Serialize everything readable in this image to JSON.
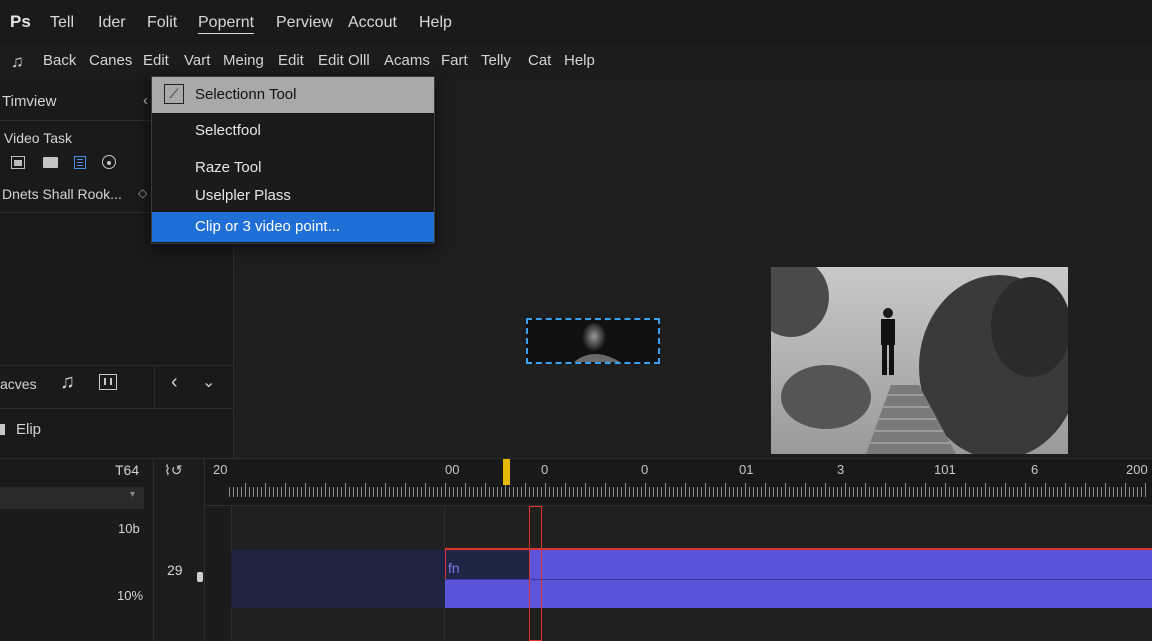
{
  "app": {
    "logo": "Ps"
  },
  "menubar": {
    "items": [
      "Tell",
      "Ider",
      "Folit",
      "Popernt",
      "Perview",
      "Accout",
      "Help"
    ]
  },
  "toolbar": {
    "items": [
      "Back",
      "Canes",
      "Edit",
      "Vart",
      "Meing",
      "Edit",
      "Edit Olll",
      "Acams",
      "Fart",
      "Telly",
      "Cat",
      "Help"
    ]
  },
  "left_panel": {
    "title": "Timview",
    "section": "Video Task",
    "row_label": "Dnets Shall Rook...",
    "tab_label": "acves",
    "clip_label": "Elip",
    "track_name": "T64",
    "value_top": "10b",
    "value_bottom": "10%",
    "track_number": "29"
  },
  "dropdown": {
    "items": [
      "Selectionn Tool",
      "Selectfool",
      "Raze Tool",
      "Uselpler Plass",
      "Clip or 3 video point..."
    ]
  },
  "timeline": {
    "ruler_labels": [
      "20",
      "00",
      "0",
      "0",
      "01",
      "3",
      "101",
      "6",
      "200"
    ],
    "clip_label": "fn"
  },
  "colors": {
    "accent": "#1f6fd6",
    "clip": "#5a55d8",
    "playhead": "#e0322e",
    "marker": "#e6b800"
  }
}
